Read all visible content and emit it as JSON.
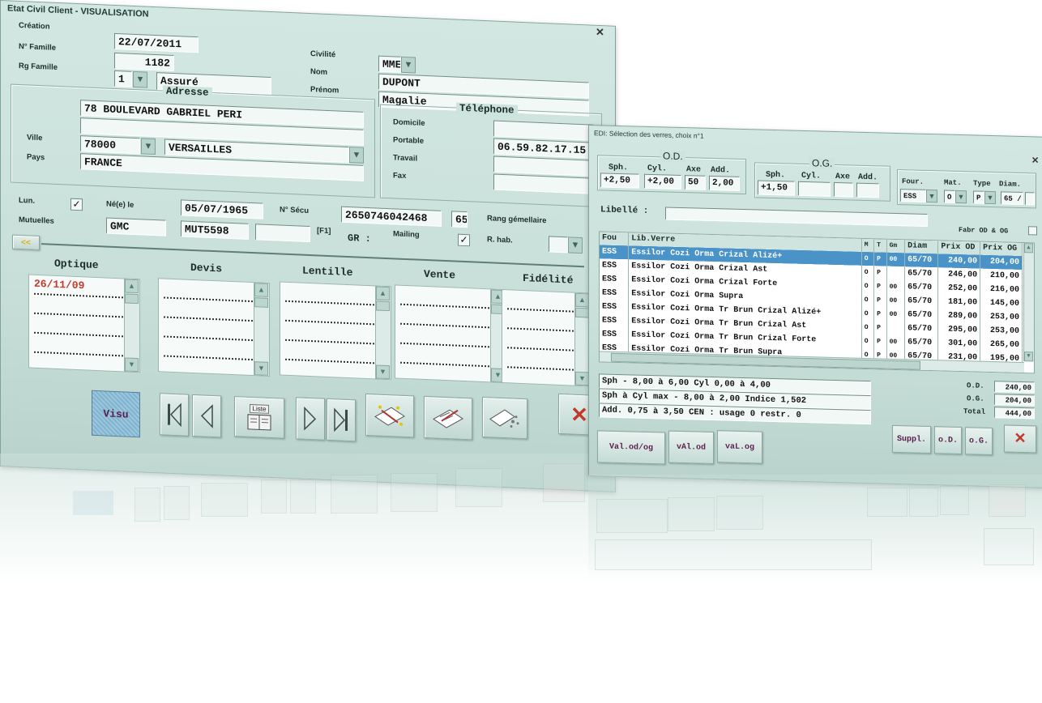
{
  "main_window": {
    "title": "Etat Civil Client - VISUALISATION",
    "labels": {
      "creation": "Création",
      "num_famille": "N° Famille",
      "rg_famille": "Rg Famille",
      "civilite": "Civilité",
      "nom": "Nom",
      "prenom": "Prénom",
      "adresse": "Adresse",
      "ville": "Ville",
      "pays": "Pays",
      "telephone": "Téléphone",
      "domicile": "Domicile",
      "portable": "Portable",
      "travail": "Travail",
      "fax": "Fax",
      "lun": "Lun.",
      "mutuelles": "Mutuelles",
      "nee_le": "Né(e) le",
      "num_secu": "N° Sécu",
      "rang_gemellaire": "Rang gémellaire",
      "f1": "[F1]",
      "gr": "GR :",
      "mailing": "Mailing",
      "r_hab": "R. hab."
    },
    "values": {
      "creation": "22/07/2011",
      "num_famille": "1182",
      "rg_famille": "1",
      "rg_famille_text": "Assuré",
      "civilite": "MME",
      "nom": "DUPONT",
      "prenom": "Magalie",
      "adresse_1": "78 BOULEVARD GABRIEL PERI",
      "adresse_2": "",
      "code_postal": "78000",
      "ville": "VERSAILLES",
      "pays": "FRANCE",
      "domicile": "",
      "portable": "06.59.82.17.15",
      "travail": "",
      "fax": "",
      "lun_checked": "✓",
      "nee_le": "05/07/1965",
      "num_secu": "2650746042468",
      "secu_cle": "65",
      "mutuelle_1": "GMC",
      "mutuelle_2": "MUT5598",
      "mutuelle_3": "",
      "mailing_checked": "✓"
    },
    "collapse_label": "<<",
    "columns": [
      {
        "title": "Optique",
        "first": "26/11/09"
      },
      {
        "title": "Devis",
        "first": ""
      },
      {
        "title": "Lentille",
        "first": ""
      },
      {
        "title": "Vente",
        "first": ""
      },
      {
        "title": "Fidélité",
        "first": ""
      }
    ],
    "buttons": {
      "visu": "Visu",
      "liste": "Liste"
    }
  },
  "edi_window": {
    "title": "EDI: Sélection des verres, choix n°1",
    "od_title": "O.D.",
    "og_title": "O.G.",
    "headers": {
      "sph": "Sph.",
      "cyl": "Cyl.",
      "axe": "Axe",
      "add": "Add.",
      "four": "Four.",
      "mat": "Mat.",
      "type": "Type",
      "diam": "Diam."
    },
    "od": {
      "sph": "+2,50",
      "cyl": "+2,00",
      "axe": "50",
      "add": "2,00"
    },
    "og": {
      "sph": "+1,50",
      "cyl": "",
      "axe": "",
      "add": ""
    },
    "four": "ESS",
    "mat": "O",
    "type": "P",
    "diam": "65 /",
    "libelle_label": "Libellé :",
    "fabr_label": "Fabr OD & OG",
    "table_headers": [
      "Fou",
      "Lib.Verre",
      "M",
      "T",
      "Gm",
      "Diam",
      "Prix OD",
      "Prix OG"
    ],
    "rows": [
      [
        "ESS",
        "Essilor Cozi Orma Crizal Alizé+",
        "O",
        "P",
        "00",
        "65/70",
        "240,00",
        "204,00"
      ],
      [
        "ESS",
        "Essilor Cozi Orma Crizal Ast",
        "O",
        "P",
        "",
        "65/70",
        "246,00",
        "210,00"
      ],
      [
        "ESS",
        "Essilor Cozi Orma Crizal Forte",
        "O",
        "P",
        "00",
        "65/70",
        "252,00",
        "216,00"
      ],
      [
        "ESS",
        "Essilor Cozi Orma Supra",
        "O",
        "P",
        "00",
        "65/70",
        "181,00",
        "145,00"
      ],
      [
        "ESS",
        "Essilor Cozi Orma Tr Brun Crizal Alizé+",
        "O",
        "P",
        "00",
        "65/70",
        "289,00",
        "253,00"
      ],
      [
        "ESS",
        "Essilor Cozi Orma Tr Brun Crizal Ast",
        "O",
        "P",
        "",
        "65/70",
        "295,00",
        "253,00"
      ],
      [
        "ESS",
        "Essilor Cozi Orma Tr Brun Crizal Forte",
        "O",
        "P",
        "00",
        "65/70",
        "301,00",
        "265,00"
      ],
      [
        "ESS",
        "Essilor Cozi Orma Tr Brun Supra",
        "O",
        "P",
        "00",
        "65/70",
        "231,00",
        "195,00"
      ]
    ],
    "info_lines": [
      "Sph - 8,00 à   6,00 Cyl  0,00 à  4,00",
      "Sph à Cyl max - 8,00 à  2,00  Indice 1,502",
      "Add.  0,75 à  3,50  CEN : usage 0 restr. 0"
    ],
    "totals": {
      "od_label": "O.D.",
      "od": "240,00",
      "og_label": "O.G.",
      "og": "204,00",
      "total_label": "Total",
      "total": "444,00"
    },
    "buttons": {
      "suppl": "Suppl.",
      "od": "o.D.",
      "og": "o.G.",
      "val_odog": "Val.od/og",
      "val_od": "vAl.od",
      "val_og": "vaL.og"
    }
  }
}
